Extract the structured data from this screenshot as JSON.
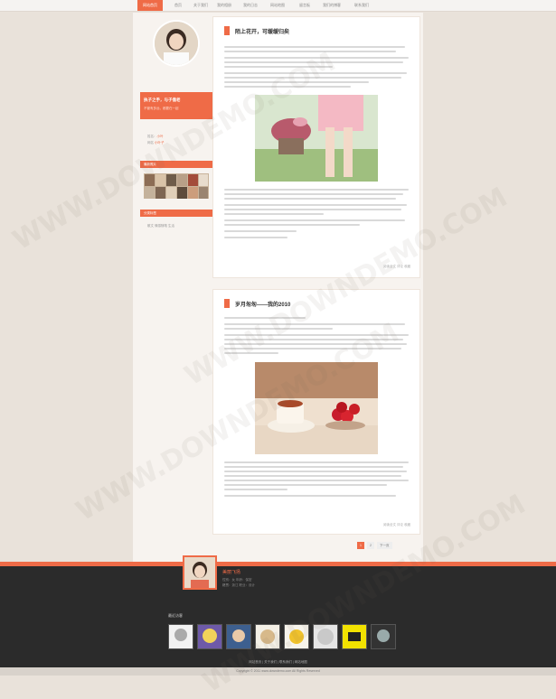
{
  "nav": {
    "items": [
      "网站首页",
      "首页",
      "关于我们",
      "我的相册",
      "我的日志",
      "网站地图",
      "留言板",
      "我们的博客",
      "联系我们"
    ]
  },
  "sidebar": {
    "orange_title": "执子之手，与子偕老",
    "orange_sub": "不管有多远，都要在一起",
    "info_line1": "姓名：",
    "info_link1": "小叶",
    "info_line2": "网名",
    "info_link2": "小叶子",
    "album_header": "最新照片",
    "tags_header": "分类标签",
    "tags": "散文  情感随笔  生活"
  },
  "posts": [
    {
      "title": "陌上花开，可缓缓归矣",
      "footer": "阅读全文  评论  收藏"
    },
    {
      "title": "岁月匆匆——我的2010",
      "footer": "阅读全文  评论  收藏"
    }
  ],
  "pager": [
    "1",
    "2",
    "下一页"
  ],
  "footer": {
    "name": "美丽飞扬",
    "meta1": "性别：女  年龄：保密",
    "meta2": "籍贯：浙江  职业：设计",
    "visitors_title": "最近访客",
    "links": "网站首页  |  关于我们  |  联系我们  |  网站地图",
    "copyright": "Copyright © 2011  www.downdemo.com  All Rights Reserved"
  },
  "watermark": "WWW.DOWNDEMO.COM",
  "colors": {
    "accent": "#ef6b47",
    "footer_bg": "#2b2b2b",
    "page_bg": "#e9e2da"
  }
}
